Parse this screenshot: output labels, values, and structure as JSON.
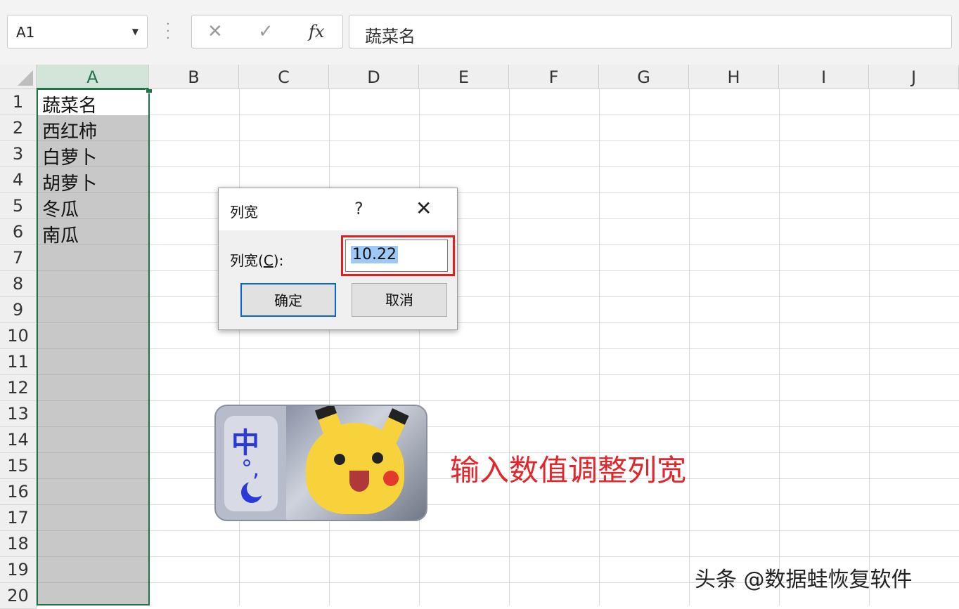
{
  "formula_bar": {
    "name_box": "A1",
    "formula": "蔬菜名"
  },
  "columns": [
    "A",
    "B",
    "C",
    "D",
    "E",
    "F",
    "G",
    "H",
    "I",
    "J"
  ],
  "rows": [
    "1",
    "2",
    "3",
    "4",
    "5",
    "6",
    "7",
    "8",
    "9",
    "10",
    "11",
    "12",
    "13",
    "14",
    "15",
    "16",
    "17",
    "18",
    "19",
    "20"
  ],
  "cells": {
    "A1": "蔬菜名",
    "A2": "西红柿",
    "A3": "白萝卜",
    "A4": "胡萝卜",
    "A5": "冬瓜",
    "A6": "南瓜"
  },
  "dialog": {
    "title": "列宽",
    "help": "?",
    "close": "✕",
    "label_prefix": "列宽(",
    "label_key": "C",
    "label_suffix": "):",
    "value": "10.22",
    "ok": "确定",
    "cancel": "取消"
  },
  "sticker": {
    "ime_char": "中",
    "ime_punct": "°,"
  },
  "annotation": "输入数值调整列宽",
  "watermark": "头条 @数据蛙恢复软件",
  "colors": {
    "selection": "#217346",
    "highlight": "#e02020",
    "annotation": "#e3262b"
  }
}
